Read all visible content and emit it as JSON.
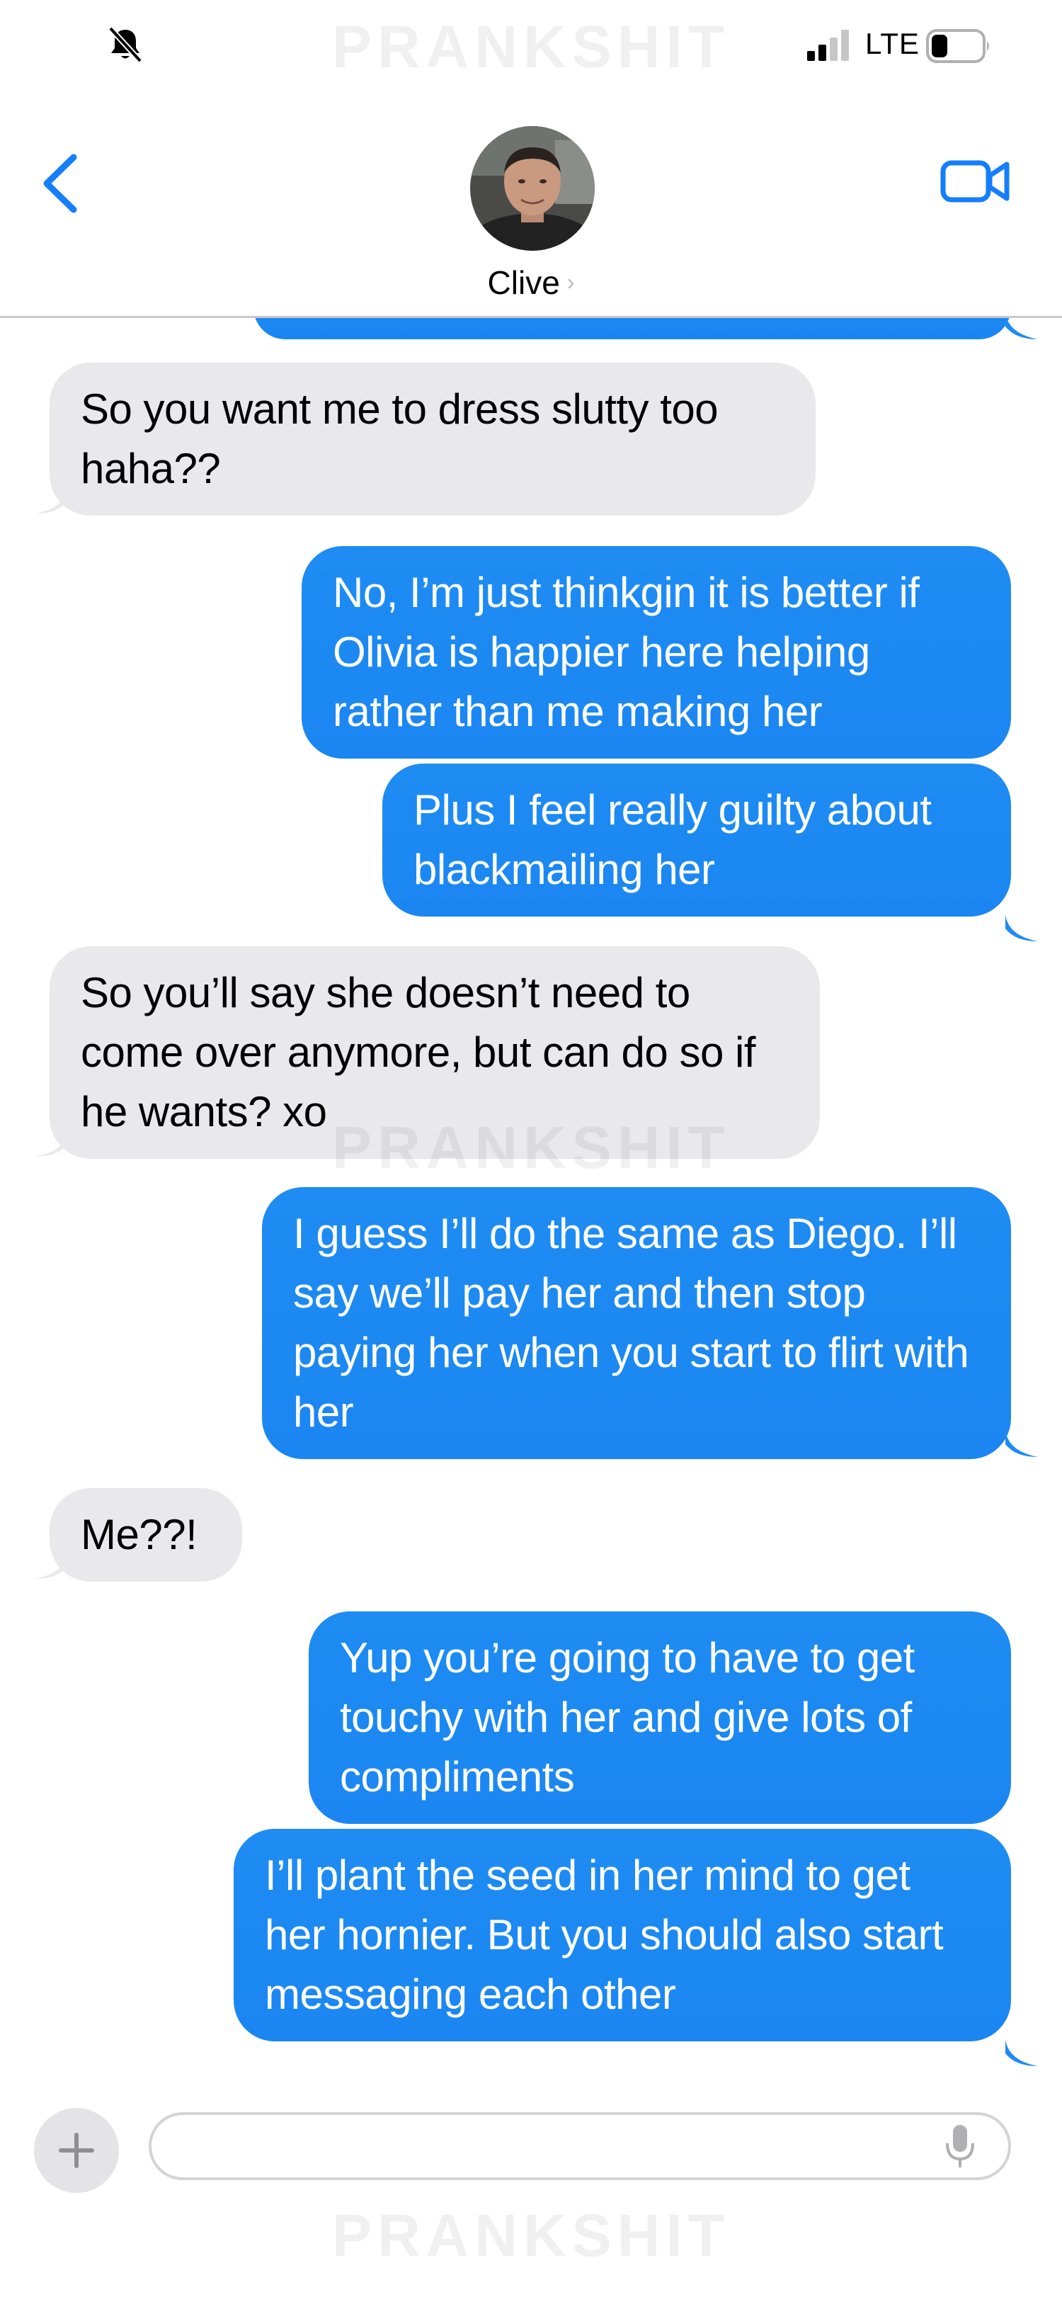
{
  "status_bar": {
    "network": "LTE",
    "signal_bars_filled": 2,
    "signal_bars_total": 4,
    "battery_level": 0.3,
    "icons": [
      "bell-slash-icon",
      "signal-icon",
      "battery-icon"
    ]
  },
  "watermark": "PRANKSHIT",
  "header": {
    "contact_name": "Clive",
    "chevron": "›",
    "icons": [
      "back-chevron-icon",
      "avatar",
      "video-camera-icon"
    ]
  },
  "messages": [
    {
      "from": "received",
      "text": "So you want me to dress slutty too haha??"
    },
    {
      "from": "sent",
      "text": "No, I’m just thinkgin it is better if Olivia is happier here helping rather than me making her"
    },
    {
      "from": "sent",
      "text": "Plus I feel really guilty about blackmailing her"
    },
    {
      "from": "received",
      "text": "So you’ll say she doesn’t need to come over anymore, but can do so if he wants? xo"
    },
    {
      "from": "sent",
      "text": "I guess I’ll do the same as Diego. I’ll say we’ll pay her and then stop paying her when you start to flirt with her"
    },
    {
      "from": "received",
      "text": "Me??!"
    },
    {
      "from": "sent",
      "text": "Yup you’re going to have to get touchy with her and give lots of compliments"
    },
    {
      "from": "sent",
      "text": "I’ll plant the seed in her mind to get her hornier. But you should also start messaging each other"
    }
  ],
  "input_bar": {
    "placeholder": "",
    "value": "",
    "icons": [
      "plus-icon",
      "microphone-icon"
    ]
  },
  "colors": {
    "sent_bubble": "#1e8cf3",
    "received_bubble": "#e9e9eb",
    "accent": "#147efb"
  }
}
